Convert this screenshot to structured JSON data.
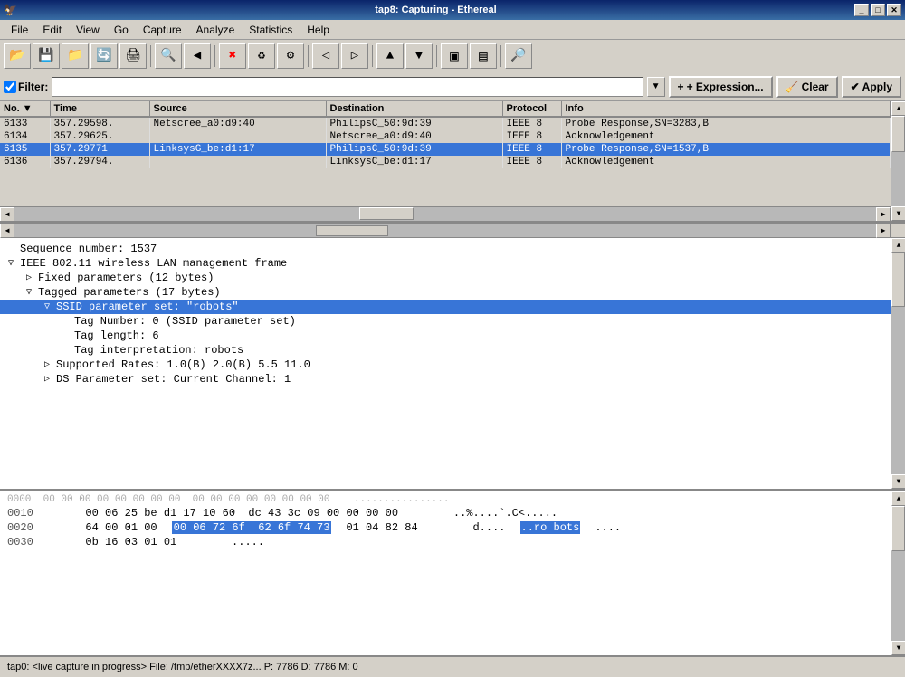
{
  "window": {
    "title": "tap8: Capturing - Ethereal",
    "min_label": "_",
    "max_label": "□",
    "close_label": "✕"
  },
  "menu": {
    "items": [
      "File",
      "Edit",
      "View",
      "Go",
      "Capture",
      "Analyze",
      "Statistics",
      "Help"
    ]
  },
  "toolbar": {
    "buttons": [
      "📄",
      "🖨",
      "🔍",
      "📷",
      "🎯",
      "✕",
      "🔄",
      "🖨",
      "🔍",
      "⬅",
      "➡",
      "⚡",
      "⬆",
      "⬇",
      "▣",
      "▤",
      "🔎"
    ]
  },
  "filter": {
    "label": "Filter:",
    "placeholder": "",
    "expression_label": "+ Expression...",
    "clear_label": "Clear",
    "apply_label": "Apply"
  },
  "packet_list": {
    "columns": [
      "No.",
      "Time",
      "Source",
      "Destination",
      "Protocol",
      "Info"
    ],
    "rows": [
      {
        "no": "6133",
        "time": "357.29598.",
        "source": "Netscree_a0:d9:40",
        "destination": "PhilipsC_50:9d:39",
        "protocol": "IEEE 8",
        "info": "Probe Response,SN=3283,B"
      },
      {
        "no": "6134",
        "time": "357.29625.",
        "source": "",
        "destination": "Netscree_a0:d9:40",
        "protocol": "IEEE 8",
        "info": "Acknowledgement"
      },
      {
        "no": "6135",
        "time": "357.29771",
        "source": "LinksysG_be:d1:17",
        "destination": "PhilipsC_50:9d:39",
        "protocol": "IEEE 8",
        "info": "Probe Response,SN=1537,B",
        "selected": true
      },
      {
        "no": "6136",
        "time": "357.29794.",
        "source": "",
        "destination": "LinksysC_be:d1:17",
        "protocol": "IEEE 8",
        "info": "Acknowledgement"
      }
    ]
  },
  "packet_detail": {
    "lines": [
      {
        "indent": 0,
        "expand": "",
        "text": "Sequence number: 1537",
        "selected": false
      },
      {
        "indent": 0,
        "expand": "▽",
        "text": "IEEE 802.11 wireless LAN management frame",
        "selected": false
      },
      {
        "indent": 1,
        "expand": "▷",
        "text": "Fixed parameters (12 bytes)",
        "selected": false
      },
      {
        "indent": 1,
        "expand": "▽",
        "text": "Tagged parameters (17 bytes)",
        "selected": false
      },
      {
        "indent": 2,
        "expand": "▽",
        "text": "SSID parameter set: \"robots\"",
        "selected": true
      },
      {
        "indent": 3,
        "expand": "",
        "text": "Tag Number: 0 (SSID parameter set)",
        "selected": false
      },
      {
        "indent": 3,
        "expand": "",
        "text": "Tag length: 6",
        "selected": false
      },
      {
        "indent": 3,
        "expand": "",
        "text": "Tag interpretation: robots",
        "selected": false
      },
      {
        "indent": 2,
        "expand": "▷",
        "text": "Supported Rates: 1.0(B) 2.0(B) 5.5 11.0",
        "selected": false
      },
      {
        "indent": 2,
        "expand": "▷",
        "text": "DS Parameter set: Current Channel: 1",
        "selected": false
      }
    ]
  },
  "hex_pane": {
    "lines": [
      {
        "offset": "0010",
        "bytes": "00 06 25 be d1 17 10 60  dc 43 3c 09 00 00 00 00",
        "ascii": "..%....`.C<.....",
        "highlight_start": -1,
        "highlight_end": -1
      },
      {
        "offset": "0020",
        "bytes_before": "64 00 01 00 ",
        "bytes_highlight": "00 06 72 6f  62 6f 74 73",
        "bytes_after": " 01 04 82 84",
        "ascii_before": "d....",
        "ascii_highlight": "..ro bots",
        "ascii_after": "....",
        "has_highlight": true
      },
      {
        "offset": "0030",
        "bytes": "0b 16 03 01 01",
        "ascii": ".....",
        "has_highlight": false
      }
    ]
  },
  "hex_top": {
    "raw": "0000  00 00 00 00 00 00 00 00  00 00 00 00 00 00 00 00    ................"
  },
  "status_bar": {
    "text": "tap0: <live capture in progress> File: /tmp/etherXXXX7z...   P: 7786 D: 7786 M: 0"
  }
}
